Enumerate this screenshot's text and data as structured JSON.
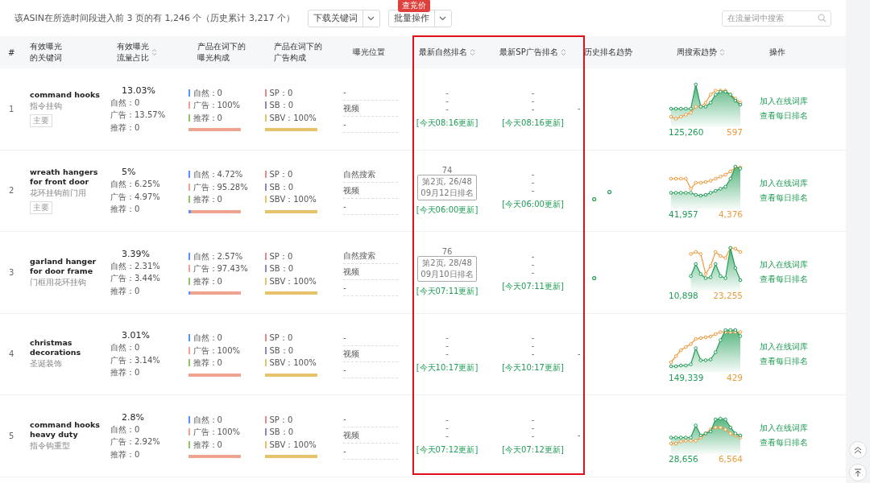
{
  "summary": "该ASIN在所选时间段进入前 3 页的有 1,246 个（历史累计 3,217 个）",
  "toolbar": {
    "download_button": "下载关键词",
    "batch_button": "批量操作",
    "batch_badge": "查竞价",
    "search": {
      "placeholder": "在流量词中搜索"
    }
  },
  "table": {
    "columns": [
      {
        "label": "#",
        "sortable": false
      },
      {
        "label": "有效曝光的关键词",
        "sortable": false
      },
      {
        "label": "有效曝光流量占比",
        "sortable": true
      },
      {
        "label": "产品在词下的曝光构成",
        "sortable": false
      },
      {
        "label": "产品在词下的广告构成",
        "sortable": false
      },
      {
        "label": "曝光位置",
        "sortable": false
      },
      {
        "label": "最新自然排名",
        "sortable": true
      },
      {
        "label": "最新SP广告排名",
        "sortable": true
      },
      {
        "label": "历史排名趋势",
        "sortable": false
      },
      {
        "label": "周搜索趋势",
        "sortable": true
      },
      {
        "label": "操作",
        "sortable": false
      }
    ],
    "rows": [
      {
        "index": "1",
        "keyword": "command hooks",
        "translation": "指令挂钩",
        "tag": "主要",
        "share": "13.03%",
        "share_lines": [
          "自然：0",
          "广告：13.57%",
          "推荐：0"
        ],
        "exposure": [
          {
            "label": "自然：0",
            "color": "#5b8ff9"
          },
          {
            "label": "广告：100%",
            "color": "#eea48f",
            "level": 1
          },
          {
            "label": "推荐：0",
            "color": "#8fc46a"
          }
        ],
        "ads": [
          {
            "label": "SP：0",
            "color": "#e88a8a"
          },
          {
            "label": "SB：0",
            "color": "#8a86c8"
          },
          {
            "label": "SBV：100%",
            "color": "#e6c36a",
            "level": 1
          }
        ],
        "positions": [
          "-",
          "视频",
          "-"
        ],
        "natural_rank": {
          "kind": "none",
          "lines": [
            "-",
            "-",
            "-"
          ],
          "update": "[今天08:16更新]"
        },
        "sp_rank": {
          "kind": "none",
          "lines": [
            "-",
            "-",
            "-"
          ],
          "update": "[今天08:16更新]"
        },
        "history": {
          "kind": "dash",
          "text": "-"
        },
        "search_volume": "125,260",
        "search_rank": "597",
        "actions": [
          "加入在线词库",
          "查看每日排名"
        ]
      },
      {
        "index": "2",
        "keyword": "wreath hangers for front door",
        "translation": "花环挂钩前门用",
        "tag": "主要",
        "share": "5%",
        "share_lines": [
          "自然：6.25%",
          "广告：4.97%",
          "推荐：0"
        ],
        "exposure": [
          {
            "label": "自然：4.72%",
            "color": "#5b8ff9",
            "level": 0.0472
          },
          {
            "label": "广告：95.28%",
            "color": "#eea48f",
            "level": 0.9528
          },
          {
            "label": "推荐：0",
            "color": "#8fc46a"
          }
        ],
        "ads": [
          {
            "label": "SP：0",
            "color": "#e88a8a"
          },
          {
            "label": "SB：0",
            "color": "#8a86c8"
          },
          {
            "label": "SBV：100%",
            "color": "#e6c36a",
            "level": 1
          }
        ],
        "positions": [
          "自然搜索",
          "视频",
          "-"
        ],
        "natural_rank": {
          "kind": "rank",
          "rank": "74",
          "page": "第2页, 26/48",
          "date": "09月12日排名",
          "update": "[今天06:00更新]"
        },
        "sp_rank": {
          "kind": "none",
          "lines": [
            "-",
            "-",
            "-"
          ],
          "update": "[今天06:00更新]"
        },
        "history": {
          "kind": "dots"
        },
        "search_volume": "41,957",
        "search_rank": "4,376",
        "actions": [
          "加入在线词库",
          "查看每日排名"
        ]
      },
      {
        "index": "3",
        "keyword": "garland hanger for door frame",
        "translation": "门框用花环挂钩",
        "share": "3.39%",
        "share_lines": [
          "自然：2.31%",
          "广告：3.44%",
          "推荐：0"
        ],
        "exposure": [
          {
            "label": "自然：2.57%",
            "color": "#5b8ff9",
            "level": 0.0257
          },
          {
            "label": "广告：97.43%",
            "color": "#eea48f",
            "level": 0.9743
          },
          {
            "label": "推荐：0",
            "color": "#8fc46a"
          }
        ],
        "ads": [
          {
            "label": "SP：0",
            "color": "#e88a8a"
          },
          {
            "label": "SB：0",
            "color": "#8a86c8"
          },
          {
            "label": "SBV：100%",
            "color": "#e6c36a",
            "level": 1
          }
        ],
        "positions": [
          "自然搜索",
          "视频",
          "-"
        ],
        "natural_rank": {
          "kind": "rank",
          "rank": "76",
          "page": "第2页, 28/48",
          "date": "09月10日排名",
          "update": "[今天07:11更新]"
        },
        "sp_rank": {
          "kind": "none",
          "lines": [
            "-",
            "-",
            "-"
          ],
          "update": "[今天07:11更新]"
        },
        "history": {
          "kind": "dots"
        },
        "search_volume": "10,898",
        "search_rank": "23,255",
        "actions": [
          "加入在线词库",
          "查看每日排名"
        ]
      },
      {
        "index": "4",
        "keyword": "christmas decorations",
        "translation": "圣诞装饰",
        "share": "3.01%",
        "share_lines": [
          "自然：0",
          "广告：3.14%",
          "推荐：0"
        ],
        "exposure": [
          {
            "label": "自然：0",
            "color": "#5b8ff9"
          },
          {
            "label": "广告：100%",
            "color": "#eea48f",
            "level": 1
          },
          {
            "label": "推荐：0",
            "color": "#8fc46a"
          }
        ],
        "ads": [
          {
            "label": "SP：0",
            "color": "#e88a8a"
          },
          {
            "label": "SB：0",
            "color": "#8a86c8"
          },
          {
            "label": "SBV：100%",
            "color": "#e6c36a",
            "level": 1
          }
        ],
        "positions": [
          "-",
          "视频",
          "-"
        ],
        "natural_rank": {
          "kind": "none",
          "lines": [
            "-",
            "-",
            "-"
          ],
          "update": "[今天10:17更新]"
        },
        "sp_rank": {
          "kind": "none",
          "lines": [
            "-",
            "-",
            "-"
          ],
          "update": "[今天10:17更新]"
        },
        "history": {
          "kind": "dash",
          "text": "-"
        },
        "search_volume": "149,339",
        "search_rank": "429",
        "actions": [
          "加入在线词库",
          "查看每日排名"
        ]
      },
      {
        "index": "5",
        "keyword": "command hooks heavy duty",
        "translation": "指令钩重型",
        "share": "2.8%",
        "share_lines": [
          "自然：0",
          "广告：2.92%",
          "推荐：0"
        ],
        "exposure": [
          {
            "label": "自然：0",
            "color": "#5b8ff9"
          },
          {
            "label": "广告：100%",
            "color": "#eea48f",
            "level": 1
          },
          {
            "label": "推荐：0",
            "color": "#8fc46a"
          }
        ],
        "ads": [
          {
            "label": "SP：0",
            "color": "#e88a8a"
          },
          {
            "label": "SB：0",
            "color": "#8a86c8"
          },
          {
            "label": "SBV：100%",
            "color": "#e6c36a",
            "level": 1
          }
        ],
        "positions": [
          "-",
          "视频",
          "-"
        ],
        "natural_rank": {
          "kind": "none",
          "lines": [
            "-",
            "-",
            "-"
          ],
          "update": "[今天07:12更新]"
        },
        "sp_rank": {
          "kind": "none",
          "lines": [
            "-",
            "-",
            "-"
          ],
          "update": "[今天07:12更新]"
        },
        "history": {
          "kind": "dash",
          "text": "-"
        },
        "search_volume": "28,656",
        "search_rank": "6,564",
        "actions": [
          "加入在线词库",
          "查看每日排名"
        ]
      }
    ]
  }
}
